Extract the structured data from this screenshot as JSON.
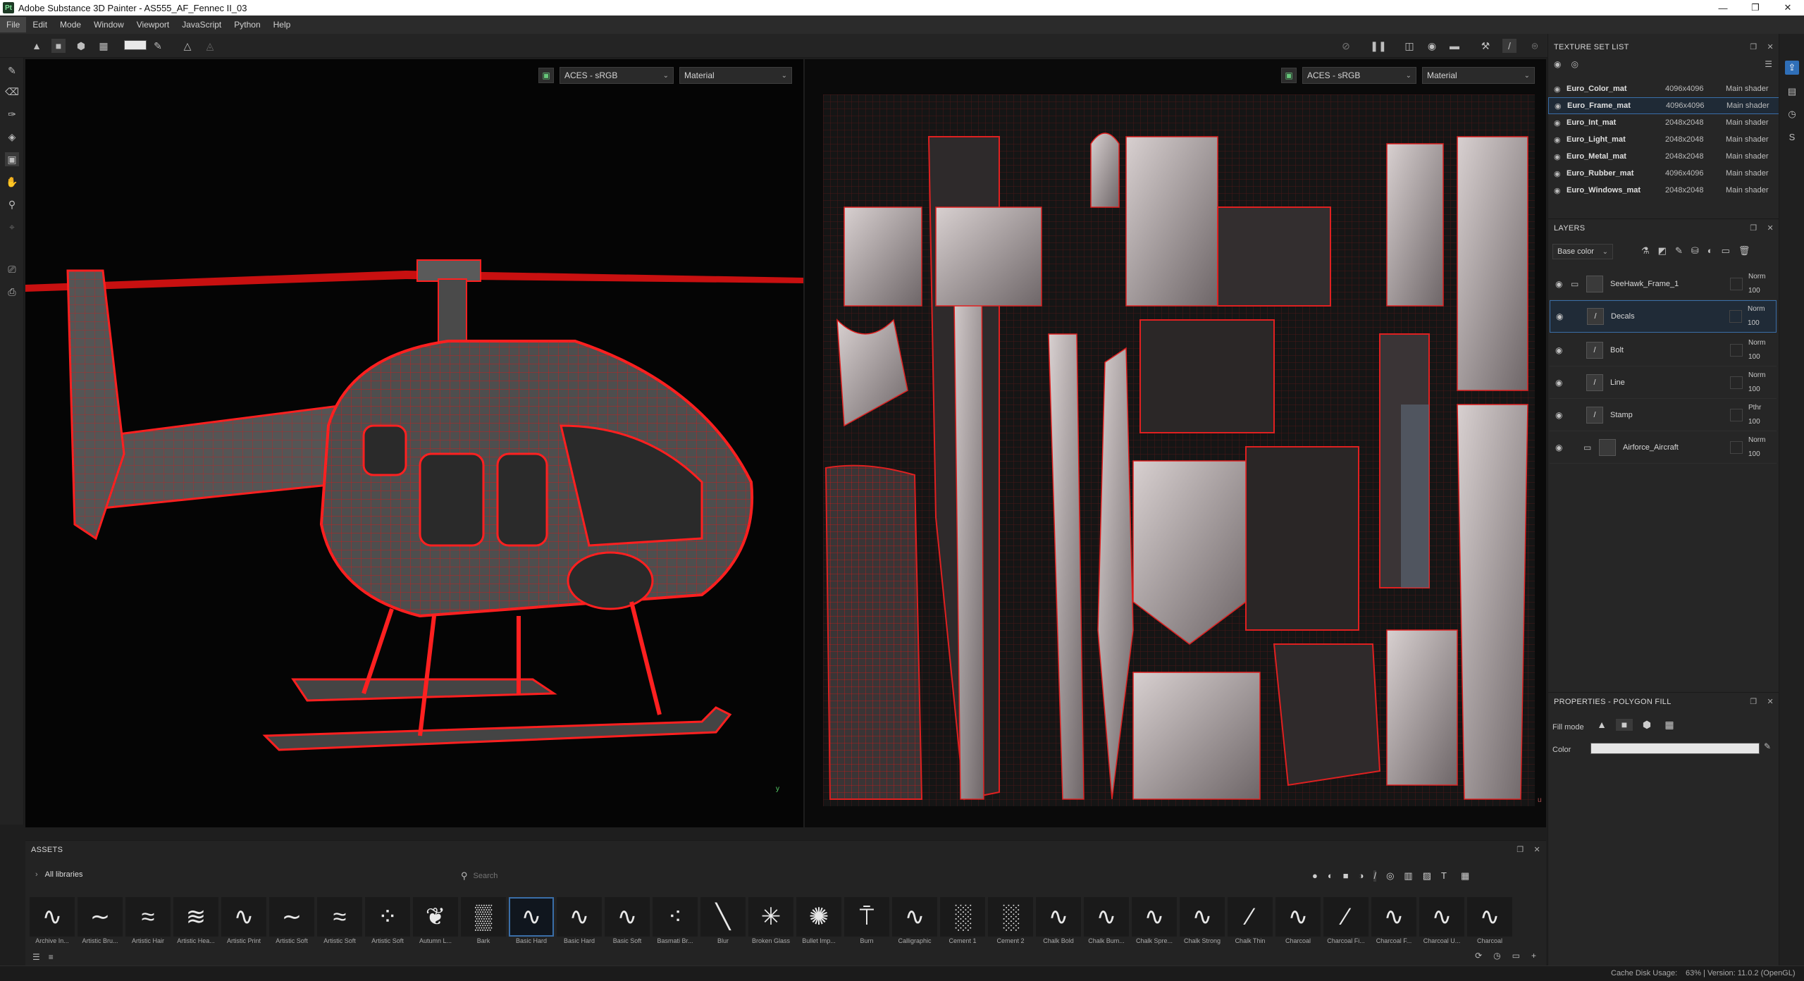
{
  "window": {
    "title": "Adobe Substance 3D Painter - AS555_AF_Fennec II_03",
    "app_badge": "Pt",
    "controls": [
      "—",
      "❐",
      "✕"
    ]
  },
  "menu": [
    "File",
    "Edit",
    "Mode",
    "Window",
    "Viewport",
    "JavaScript",
    "Python",
    "Help"
  ],
  "viewport3d": {
    "colorspace": "ACES - sRGB",
    "channel": "Material",
    "axis_label": "y"
  },
  "viewport2d": {
    "colorspace": "ACES - sRGB",
    "channel": "Material",
    "axis_label": "u"
  },
  "texture_set_list": {
    "title": "TEXTURE SET LIST",
    "items": [
      {
        "name": "Euro_Color_mat",
        "resolution": "4096x4096",
        "shader": "Main shader"
      },
      {
        "name": "Euro_Frame_mat",
        "resolution": "4096x4096",
        "shader": "Main shader"
      },
      {
        "name": "Euro_Int_mat",
        "resolution": "2048x2048",
        "shader": "Main shader"
      },
      {
        "name": "Euro_Light_mat",
        "resolution": "2048x2048",
        "shader": "Main shader"
      },
      {
        "name": "Euro_Metal_mat",
        "resolution": "2048x2048",
        "shader": "Main shader"
      },
      {
        "name": "Euro_Rubber_mat",
        "resolution": "4096x4096",
        "shader": "Main shader"
      },
      {
        "name": "Euro_Windows_mat",
        "resolution": "2048x2048",
        "shader": "Main shader"
      }
    ]
  },
  "layers": {
    "title": "LAYERS",
    "channel_select": "Base color",
    "items": [
      {
        "name": "SeeHawk_Frame_1",
        "blend": "Norm",
        "opacity": "100"
      },
      {
        "name": "Decals",
        "blend": "Norm",
        "opacity": "100"
      },
      {
        "name": "Bolt",
        "blend": "Norm",
        "opacity": "100"
      },
      {
        "name": "Line",
        "blend": "Norm",
        "opacity": "100"
      },
      {
        "name": "Stamp",
        "blend": "Pthr",
        "opacity": "100"
      },
      {
        "name": "Airforce_Aircraft",
        "blend": "Norm",
        "opacity": "100"
      }
    ]
  },
  "properties": {
    "title": "PROPERTIES - POLYGON FILL",
    "fill_mode_label": "Fill mode",
    "color_label": "Color",
    "color_value": "#e6e6e6"
  },
  "assets": {
    "title": "ASSETS",
    "library": "All libraries",
    "search_placeholder": "Search",
    "items": [
      "Archive In...",
      "Artistic Bru...",
      "Artistic Hair",
      "Artistic Hea...",
      "Artistic Print",
      "Artistic Soft",
      "Artistic Soft",
      "Artistic Soft",
      "Autumn L...",
      "Bark",
      "Basic Hard",
      "Basic Hard",
      "Basic Soft",
      "Basmati Br...",
      "Blur",
      "Broken Glass",
      "Bullet Imp...",
      "Burn",
      "Calligraphic",
      "Cement 1",
      "Cement 2",
      "Chalk Bold",
      "Chalk Bum...",
      "Chalk Spre...",
      "Chalk Strong",
      "Chalk Thin",
      "Charcoal",
      "Charcoal Fi...",
      "Charcoal F...",
      "Charcoal U...",
      "Charcoal"
    ]
  },
  "status": {
    "cache": "Cache Disk Usage:",
    "version": "63% | Version: 11.0.2 (OpenGL)"
  },
  "colors": {
    "wire": "#ff1a1a",
    "accent": "#3a6ea8",
    "bg": "#1e1e1e"
  }
}
